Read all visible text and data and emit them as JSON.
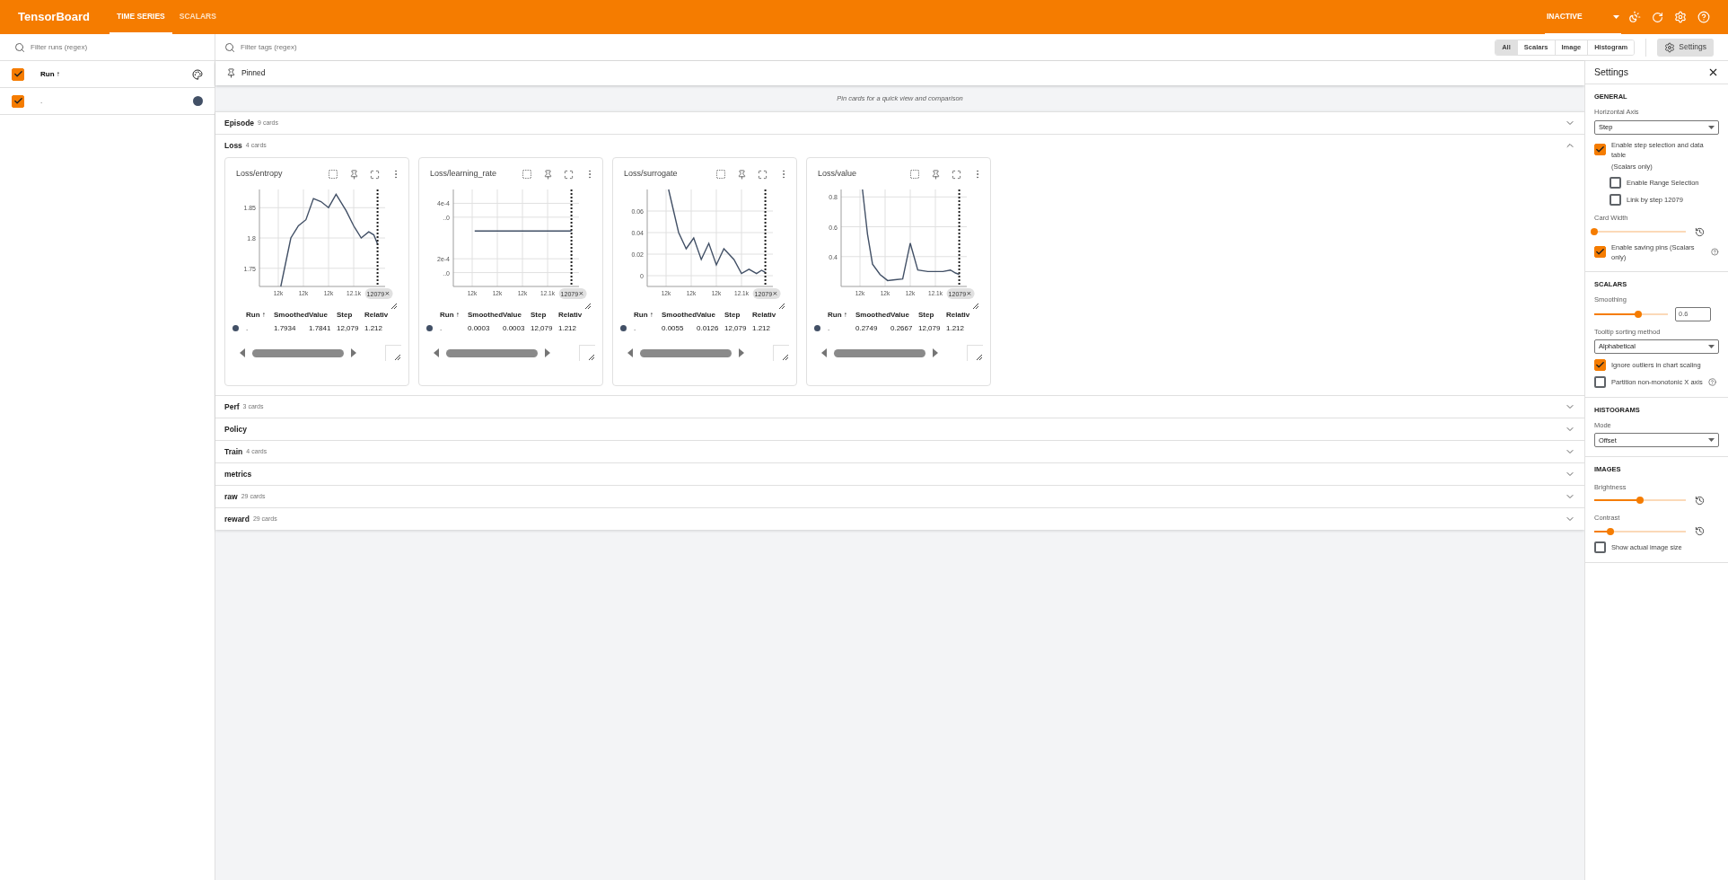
{
  "app_bar": {
    "title": "TensorBoard",
    "tabs": [
      {
        "label": "TIME SERIES",
        "selected": true
      },
      {
        "label": "SCALARS",
        "selected": false
      }
    ],
    "status": "INACTIVE"
  },
  "runs": {
    "placeholder": "Filter runs (regex)",
    "header": {
      "label": "Run ↑",
      "checked": true
    },
    "items": [
      {
        "name": ".",
        "checked": true,
        "color": "#425066"
      }
    ]
  },
  "toolbar": {
    "placeholder": "Filter tags (regex)",
    "filters": [
      {
        "label": "All",
        "selected": true
      },
      {
        "label": "Scalars",
        "selected": false
      },
      {
        "label": "Image",
        "selected": false
      },
      {
        "label": "Histogram",
        "selected": false
      }
    ],
    "settings_button": "Settings"
  },
  "pinned": {
    "title": "Pinned",
    "empty_text": "Pin cards for a quick view and comparison"
  },
  "groups": [
    {
      "name": "Episode",
      "count": "9 cards",
      "expanded": false
    },
    {
      "name": "Loss",
      "count": "4 cards",
      "expanded": true,
      "cards": [
        {
          "title": "Loss/entropy",
          "columns": [
            "Run ↑",
            "Smoothed",
            "Value",
            "Step",
            "Relativ"
          ],
          "row": {
            "run": ".",
            "color": "#425066",
            "smoothed": "1.7934",
            "value": "1.7841",
            "step": "12,079",
            "relative": "1.212"
          },
          "chart_data": {
            "type": "line",
            "x": [
              12002,
              12006,
              12010,
              12016,
              12022,
              12028,
              12034,
              12040,
              12046,
              12054,
              12060,
              12066,
              12072,
              12076,
              12079
            ],
            "xlim": [
              11985,
              12085
            ],
            "ylim": [
              1.72,
              1.88
            ],
            "xticks": [
              {
                "value": 12000,
                "label": "12k"
              },
              {
                "value": 12020,
                "label": "12k"
              },
              {
                "value": 12040,
                "label": "12k"
              },
              {
                "value": 12060,
                "label": "12.1k"
              }
            ],
            "yticks": [
              1.75,
              1.8,
              1.85
            ],
            "grid": true,
            "ref_lines": [
              {
                "axis": "x",
                "value": 12079,
                "label": "12079"
              }
            ],
            "series": [
              {
                "color": "#425066",
                "values": [
                  1.72,
                  1.76,
                  1.8,
                  1.82,
                  1.83,
                  1.865,
                  1.86,
                  1.85,
                  1.872,
                  1.845,
                  1.82,
                  1.8,
                  1.81,
                  1.805,
                  1.79
                ]
              }
            ]
          }
        },
        {
          "title": "Loss/learning_rate",
          "columns": [
            "Run ↑",
            "Smoothed",
            "Value",
            "Step",
            "Relativ"
          ],
          "row": {
            "run": ".",
            "color": "#425066",
            "smoothed": "0.0003",
            "value": "0.0003",
            "step": "12,079",
            "relative": "1.212"
          },
          "chart_data": {
            "type": "line",
            "x": [
              12002,
              12079
            ],
            "xlim": [
              11985,
              12085
            ],
            "ylim": [
              0.0001,
              0.00045
            ],
            "xticks": [
              {
                "value": 12000,
                "label": "12k"
              },
              {
                "value": 12020,
                "label": "12k"
              },
              {
                "value": 12040,
                "label": "12k"
              },
              {
                "value": 12060,
                "label": "12.1k"
              }
            ],
            "yticks": [
              {
                "value": 0.0004,
                "label": "4e-4"
              },
              {
                "value": 0.00035,
                "label": "..0"
              },
              {
                "value": 0.0002,
                "label": "2e-4"
              },
              {
                "value": 0.00015,
                "label": "..0"
              }
            ],
            "grid": true,
            "ref_lines": [
              {
                "axis": "x",
                "value": 12079,
                "label": "12079"
              }
            ],
            "series": [
              {
                "color": "#425066",
                "values": [
                  0.0003,
                  0.0003
                ]
              }
            ]
          }
        },
        {
          "title": "Loss/surrogate",
          "columns": [
            "Run ↑",
            "Smoothed",
            "Value",
            "Step",
            "Relativ"
          ],
          "row": {
            "run": ".",
            "color": "#425066",
            "smoothed": "0.0055",
            "value": "0.0126",
            "step": "12,079",
            "relative": "1.212"
          },
          "chart_data": {
            "type": "line",
            "x": [
              12002,
              12006,
              12010,
              12016,
              12022,
              12028,
              12034,
              12040,
              12046,
              12054,
              12060,
              12066,
              12072,
              12076,
              12079
            ],
            "xlim": [
              11985,
              12085
            ],
            "ylim": [
              -0.01,
              0.08
            ],
            "xticks": [
              {
                "value": 12000,
                "label": "12k"
              },
              {
                "value": 12020,
                "label": "12k"
              },
              {
                "value": 12040,
                "label": "12k"
              },
              {
                "value": 12060,
                "label": "12.1k"
              }
            ],
            "yticks": [
              0,
              0.02,
              0.04,
              0.06
            ],
            "grid": true,
            "ref_lines": [
              {
                "axis": "x",
                "value": 12079,
                "label": "12079"
              }
            ],
            "series": [
              {
                "color": "#425066",
                "values": [
                  0.08,
                  0.06,
                  0.04,
                  0.025,
                  0.035,
                  0.015,
                  0.03,
                  0.01,
                  0.025,
                  0.015,
                  0.002,
                  0.006,
                  0.002,
                  0.005,
                  0.003
                ]
              }
            ]
          }
        },
        {
          "title": "Loss/value",
          "columns": [
            "Run ↑",
            "Smoothed",
            "Value",
            "Step",
            "Relativ"
          ],
          "row": {
            "run": ".",
            "color": "#425066",
            "smoothed": "0.2749",
            "value": "0.2667",
            "step": "12,079",
            "relative": "1.212"
          },
          "chart_data": {
            "type": "line",
            "x": [
              12002,
              12006,
              12010,
              12016,
              12022,
              12028,
              12034,
              12040,
              12046,
              12054,
              12060,
              12066,
              12072,
              12076,
              12079
            ],
            "xlim": [
              11985,
              12085
            ],
            "ylim": [
              0.2,
              0.85
            ],
            "xticks": [
              {
                "value": 12000,
                "label": "12k"
              },
              {
                "value": 12020,
                "label": "12k"
              },
              {
                "value": 12040,
                "label": "12k"
              },
              {
                "value": 12060,
                "label": "12.1k"
              }
            ],
            "yticks": [
              0.4,
              0.6,
              0.8
            ],
            "grid": true,
            "ref_lines": [
              {
                "axis": "x",
                "value": 12079,
                "label": "12079"
              }
            ],
            "series": [
              {
                "color": "#425066",
                "values": [
                  0.85,
                  0.55,
                  0.35,
                  0.28,
                  0.24,
                  0.245,
                  0.25,
                  0.49,
                  0.31,
                  0.3,
                  0.3,
                  0.3,
                  0.31,
                  0.29,
                  0.28
                ]
              }
            ]
          }
        }
      ]
    },
    {
      "name": "Perf",
      "count": "3 cards",
      "expanded": false
    },
    {
      "name": "Policy",
      "expanded": false
    },
    {
      "name": "Train",
      "count": "4 cards",
      "expanded": false
    },
    {
      "name": "metrics",
      "expanded": false
    },
    {
      "name": "raw",
      "count": "29 cards",
      "expanded": false
    },
    {
      "name": "reward",
      "count": "29 cards",
      "expanded": false
    }
  ],
  "settings": {
    "title": "Settings",
    "sections": [
      {
        "heading": "GENERAL",
        "items": [
          {
            "kind": "select",
            "label": "Horizontal Axis",
            "value": "Step"
          },
          {
            "kind": "checkbox",
            "label": "Enable step selection and data table",
            "note": "(Scalars only)",
            "checked": true,
            "children": [
              {
                "kind": "checkbox",
                "label": "Enable Range Selection",
                "checked": false
              },
              {
                "kind": "checkbox",
                "label": "Link by step 12079",
                "checked": false
              }
            ]
          },
          {
            "kind": "slider",
            "label": "Card Width",
            "level": 0
          },
          {
            "kind": "checkbox",
            "label": "Enable saving pins (Scalars only)",
            "checked": true,
            "help": true
          }
        ]
      },
      {
        "heading": "SCALARS",
        "items": [
          {
            "kind": "slider_input",
            "label": "Smoothing",
            "level": 0.6,
            "value": "0.6"
          },
          {
            "kind": "select",
            "label": "Tooltip sorting method",
            "value": "Alphabetical"
          },
          {
            "kind": "checkbox",
            "label": "Ignore outliers in chart scaling",
            "checked": true
          },
          {
            "kind": "checkbox",
            "label": "Partition non-monotonic X axis",
            "checked": false,
            "help": true
          }
        ]
      },
      {
        "heading": "HISTOGRAMS",
        "items": [
          {
            "kind": "select",
            "label": "Mode",
            "value": "Offset"
          }
        ]
      },
      {
        "heading": "IMAGES",
        "items": [
          {
            "kind": "slider",
            "label": "Brightness",
            "level": 0.5
          },
          {
            "kind": "slider",
            "label": "Contrast",
            "level": 0.18
          },
          {
            "kind": "checkbox",
            "label": "Show actual image size",
            "checked": false
          }
        ]
      }
    ]
  }
}
